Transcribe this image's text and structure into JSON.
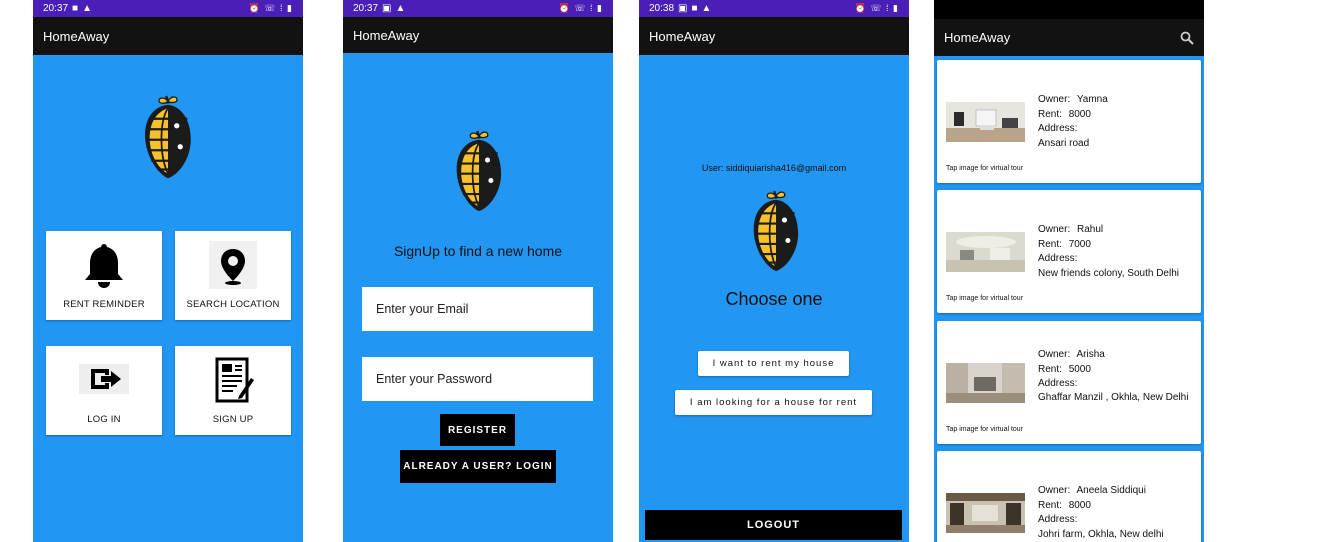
{
  "screens": [
    {
      "status": {
        "time": "20:37"
      },
      "app_title": "HomeAway",
      "tiles": [
        {
          "label": "RENT REMINDER",
          "icon": "bell-icon"
        },
        {
          "label": "SEARCH LOCATION",
          "icon": "location-pin-icon"
        },
        {
          "label": "LOG IN",
          "icon": "login-arrow-icon"
        },
        {
          "label": "SIGN UP",
          "icon": "document-pen-icon"
        }
      ]
    },
    {
      "status": {
        "time": "20:37"
      },
      "app_title": "HomeAway",
      "signup_text": "SignUp to find a new home",
      "email_placeholder": "Enter your Email",
      "password_placeholder": "Enter your Password",
      "register_label": "REGISTER",
      "login_label": "ALREADY A USER? LOGIN"
    },
    {
      "status": {
        "time": "20:38"
      },
      "app_title": "HomeAway",
      "user_text": "User: siddiquiarisha416@gmail.com",
      "choose_text": "Choose one",
      "rent_house_label": "I want to rent my house",
      "looking_house_label": "I am looking for a house for rent",
      "logout_label": "LOGOUT"
    },
    {
      "app_title": "HomeAway",
      "tap_text": "Tap image for virtual tour",
      "listings": [
        {
          "owner_label": "Owner:",
          "owner": "Yamna",
          "rent_label": "Rent:",
          "rent": "8000",
          "address_label": "Address:",
          "address": "Ansari road"
        },
        {
          "owner_label": "Owner:",
          "owner": "Rahul",
          "rent_label": "Rent:",
          "rent": "7000",
          "address_label": "Address:",
          "address": "New friends colony, South Delhi"
        },
        {
          "owner_label": "Owner:",
          "owner": "Arisha",
          "rent_label": "Rent:",
          "rent": "5000",
          "address_label": "Address:",
          "address": "Ghaffar Manzil , Okhla, New Delhi"
        },
        {
          "owner_label": "Owner:",
          "owner": "Aneela Siddiqui",
          "rent_label": "Rent:",
          "rent": "8000",
          "address_label": "Address:",
          "address": "Johri farm, Okhla, New delhi"
        }
      ]
    }
  ],
  "colors": {
    "primary": "#2196f3",
    "appbar": "#121212",
    "statusbar": "#4a1fb8",
    "accent_yellow": "#f6c12a"
  }
}
